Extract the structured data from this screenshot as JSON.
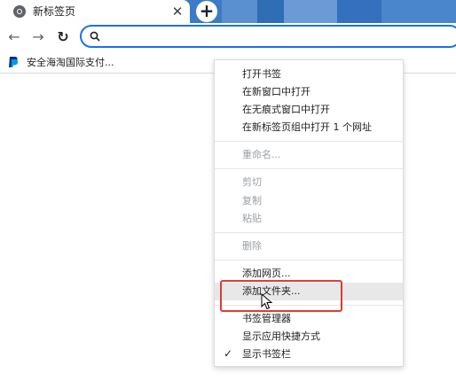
{
  "tab": {
    "title": "新标签页"
  },
  "omnibox": {
    "value": "",
    "placeholder": ""
  },
  "bookmarks": [
    {
      "label": "安全海淘国际支付..."
    }
  ],
  "menu": {
    "items": [
      {
        "label": "打开书签",
        "enabled": true
      },
      {
        "label": "在新窗口中打开",
        "enabled": true
      },
      {
        "label": "在无痕式窗口中打开",
        "enabled": true
      },
      {
        "label": "在新标签页组中打开 1 个网址",
        "enabled": true
      },
      {
        "label": "重命名...",
        "enabled": false
      },
      {
        "label": "剪切",
        "enabled": false
      },
      {
        "label": "复制",
        "enabled": false
      },
      {
        "label": "粘贴",
        "enabled": false
      },
      {
        "label": "删除",
        "enabled": false
      },
      {
        "label": "添加网页...",
        "enabled": true
      },
      {
        "label": "添加文件夹...",
        "enabled": true,
        "hovered": true
      },
      {
        "label": "书签管理器",
        "enabled": true
      },
      {
        "label": "显示应用快捷方式",
        "enabled": true
      },
      {
        "label": "显示书签栏",
        "enabled": true,
        "checked": true
      }
    ]
  },
  "colors": {
    "accent": "#1a73e8",
    "tabstrip": "#3b7bc8",
    "highlight": "#e53935"
  }
}
